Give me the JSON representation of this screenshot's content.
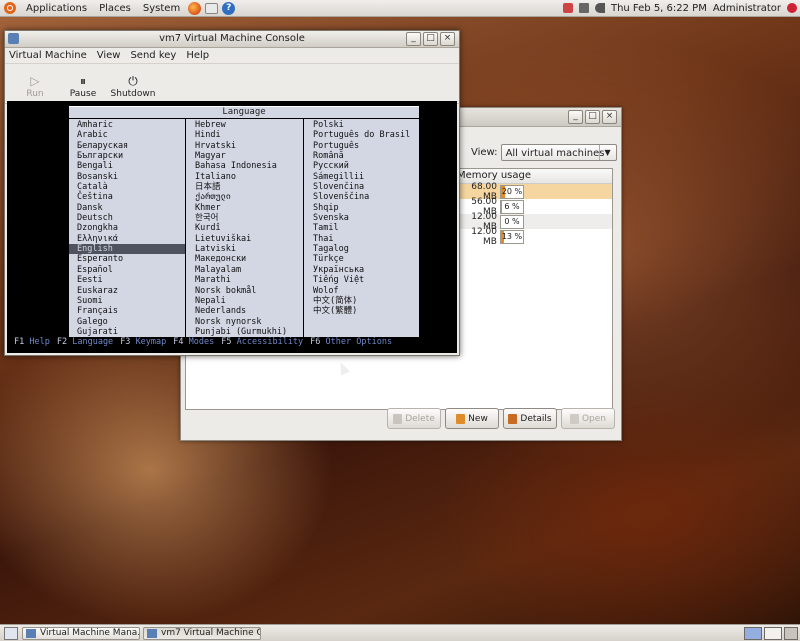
{
  "top_panel": {
    "menus": [
      "Applications",
      "Places",
      "System"
    ],
    "launchers": [
      "firefox-icon",
      "mail-icon",
      "help-icon"
    ],
    "clock": "Thu Feb  5,  6:22 PM",
    "user": "Administrator"
  },
  "manager": {
    "view_label": "View:",
    "view_value": "All virtual machines",
    "column_header": "Memory usage",
    "rows": [
      {
        "mem": "68.00 MB",
        "pct_label": "20 %",
        "pct": 20
      },
      {
        "mem": "56.00 MB",
        "pct_label": "6 %",
        "pct": 6
      },
      {
        "mem": "12.00 MB",
        "pct_label": "0 %",
        "pct": 0
      },
      {
        "mem": "12.00 MB",
        "pct_label": "13 %",
        "pct": 13
      }
    ],
    "buttons": {
      "delete": "Delete",
      "new": "New",
      "details": "Details",
      "open": "Open"
    }
  },
  "console": {
    "title": "vm7 Virtual Machine Console",
    "menu": [
      "Virtual Machine",
      "View",
      "Send key",
      "Help"
    ],
    "toolbar": {
      "run": "Run",
      "pause": "Pause",
      "shutdown": "Shutdown"
    },
    "language_title": "Language",
    "col1": [
      "Amharic",
      "Arabic",
      "Беларуская",
      "Български",
      "Bengali",
      "Bosanski",
      "Català",
      "Čeština",
      "Dansk",
      "Deutsch",
      "Dzongkha",
      "Ελληνικά",
      "English",
      "Esperanto",
      "Español",
      "Eesti",
      "Euskaraz",
      "Suomi",
      "Français",
      "Galego",
      "Gujarati"
    ],
    "col2": [
      "Hebrew",
      "Hindi",
      "Hrvatski",
      "Magyar",
      "Bahasa Indonesia",
      "Italiano",
      "日本語",
      "ქართული",
      "Khmer",
      "한국어",
      "Kurdî",
      "Lietuviškai",
      "Latviski",
      "Македонски",
      "Malayalam",
      "Marathi",
      "Norsk bokmål",
      "Nepali",
      "Nederlands",
      "Norsk nynorsk",
      "Punjabi (Gurmukhi)"
    ],
    "col3": [
      "Polski",
      "Português do Brasil",
      "Português",
      "Română",
      "Русский",
      "Sámegillii",
      "Slovenčina",
      "Slovenščina",
      "Shqip",
      "Svenska",
      "Tamil",
      "Thai",
      "Tagalog",
      "Türkçe",
      "Українська",
      "Tiếng Việt",
      "Wolof",
      "中文(简体)",
      "中文(繁體)"
    ],
    "selected": "English",
    "fkeys": [
      {
        "key": "F1",
        "label": "Help"
      },
      {
        "key": "F2",
        "label": "Language"
      },
      {
        "key": "F3",
        "label": "Keymap"
      },
      {
        "key": "F4",
        "label": "Modes"
      },
      {
        "key": "F5",
        "label": "Accessibility"
      },
      {
        "key": "F6",
        "label": "Other Options"
      }
    ]
  },
  "taskbar": {
    "tasks": [
      "Virtual Machine Mana...",
      "vm7 Virtual Machine C..."
    ]
  },
  "colors": {
    "accent_orange": "#e08c2a",
    "selection": "#f6d6a0",
    "console_bg": "#000000",
    "installer_box": "#d3d7e4"
  }
}
